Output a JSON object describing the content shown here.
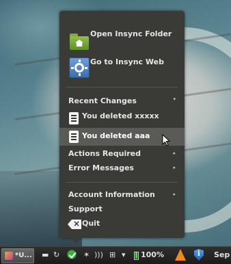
{
  "menu": {
    "open_folder": "Open Insync Folder",
    "go_to_web": "Go to Insync Web",
    "recent_changes": "Recent Changes",
    "recent_items": [
      "You deleted xxxxx",
      "You deleted aaa"
    ],
    "actions_required": "Actions Required",
    "error_messages": "Error Messages",
    "account_information": "Account Information",
    "support": "Support",
    "quit": "Quit",
    "submenu_arrow": "▸",
    "expanded_arrow": "▾"
  },
  "taskbar": {
    "task_label": "*U...",
    "battery_percent": "100%",
    "clock": "Sep"
  },
  "colors": {
    "menu_bg": "#3a3a37",
    "highlight": "#5a5a56",
    "insync_green": "#3fae3f"
  }
}
